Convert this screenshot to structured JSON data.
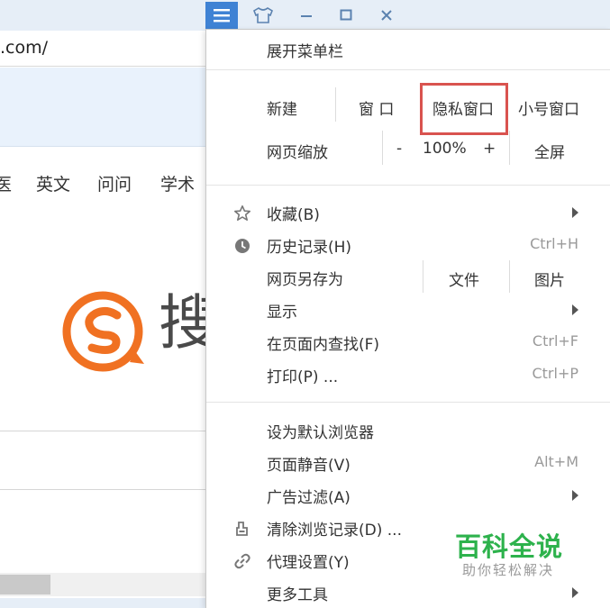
{
  "browser": {
    "address_text": ".com/",
    "nav_items": [
      "医",
      "英文",
      "问问",
      "学术"
    ],
    "logo_char": "搜"
  },
  "titlebar": {
    "icons": [
      "menu-icon",
      "skin-icon",
      "minimize-icon",
      "maximize-icon",
      "close-icon"
    ],
    "menu_button_color": "#3f82d4"
  },
  "menu": {
    "expand_menubar": "展开菜单栏",
    "new_label": "新建",
    "window_label": "窗 口",
    "incognito_label": "隐私窗口",
    "small_window_label": "小号窗口",
    "zoom_label": "网页缩放",
    "zoom_minus": "-",
    "zoom_value": "100%",
    "zoom_plus": "+",
    "fullscreen_label": "全屏",
    "favorites": "收藏(B)",
    "history": "历史记录(H)",
    "history_shortcut": "Ctrl+H",
    "save_as": "网页另存为",
    "save_file": "文件",
    "save_image": "图片",
    "display": "显示",
    "find": "在页面内查找(F)",
    "find_shortcut": "Ctrl+F",
    "print": "打印(P) ...",
    "print_shortcut": "Ctrl+P",
    "default_browser": "设为默认浏览器",
    "mute": "页面静音(V)",
    "mute_shortcut": "Alt+M",
    "adblock": "广告过滤(A)",
    "clear_history": "清除浏览记录(D) ...",
    "proxy": "代理设置(Y)",
    "more_tools": "更多工具",
    "highlight_color": "#d9534f"
  },
  "watermark": {
    "title": "百科全说",
    "subtitle": "助你轻松解决"
  }
}
